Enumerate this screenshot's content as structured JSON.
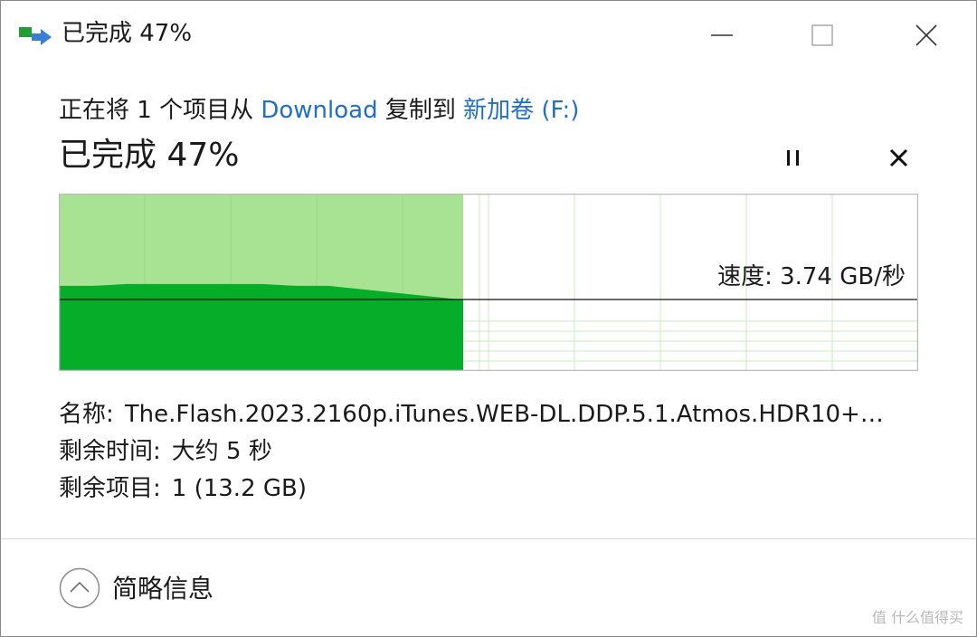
{
  "window": {
    "title": "已完成 47%"
  },
  "operation": {
    "prefix": "正在将 1 个项目从 ",
    "source": "Download",
    "middle": " 复制到 ",
    "destination": "新加卷 (F:)"
  },
  "progress": {
    "title": "已完成 47%",
    "percent": 47,
    "speed_label": "速度: 3.74 GB/秒",
    "speed_history_relative": [
      0.48,
      0.48,
      0.49,
      0.49,
      0.49,
      0.49,
      0.49,
      0.48,
      0.48,
      0.46,
      0.44,
      0.42,
      0.4
    ]
  },
  "details": {
    "name_label": "名称:",
    "name_value": "The.Flash.2023.2160p.iTunes.WEB-DL.DDP.5.1.Atmos.HDR10+…",
    "time_label": "剩余时间:",
    "time_value": "大约 5 秒",
    "items_label": "剩余项目:",
    "items_value": "1 (13.2 GB)"
  },
  "footer": {
    "collapse_label": "简略信息"
  },
  "watermark": "值 什么值得买",
  "colors": {
    "graph_fill_light": "#a8e394",
    "graph_fill_dark": "#06ad28",
    "graph_grid": "#c8ebc1",
    "link": "#1f6fc5"
  },
  "icons": {
    "app": "copy-files-icon",
    "minimize": "minimize-icon",
    "maximize": "maximize-icon",
    "close": "close-icon",
    "pause": "pause-icon",
    "cancel": "cancel-icon",
    "collapse": "chevron-up-icon"
  }
}
